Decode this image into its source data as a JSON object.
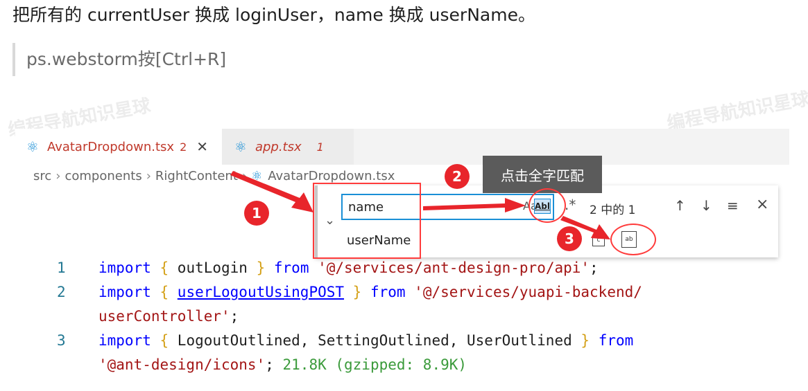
{
  "article": {
    "instruction": "把所有的 currentUser 换成 loginUser，name 换成 userName。",
    "tip": "ps.webstorm按[Ctrl+R]"
  },
  "watermark": "编程导航知识星球",
  "tabs": [
    {
      "label": "AvatarDropdown.tsx",
      "badge": "2",
      "close": "✕"
    },
    {
      "label": "app.tsx",
      "badge": "1"
    }
  ],
  "breadcrumb": [
    "src",
    "components",
    "RightContent",
    "AvatarDropdown.tsx"
  ],
  "tooltip": "点击全字匹配",
  "find_widget": {
    "find_value": "name",
    "replace_value": "userName",
    "whole_word_label": "Abl",
    "regex_label": ".*",
    "match_count": "2 中的 1"
  },
  "markers": [
    "1",
    "2",
    "3"
  ],
  "code": [
    {
      "num": "1",
      "tokens": [
        [
          "kw",
          "import"
        ],
        [
          "br",
          " { "
        ],
        [
          "id",
          "outLogin"
        ],
        [
          "br",
          " } "
        ],
        [
          "kw",
          "from"
        ],
        [
          "str",
          " '@/services/ant-design-pro/api'"
        ],
        [
          "id",
          ";"
        ]
      ]
    },
    {
      "num": "2",
      "tokens": [
        [
          "kw",
          "import"
        ],
        [
          "br",
          " { "
        ],
        [
          "link",
          "userLogoutUsingPOST"
        ],
        [
          "br",
          " } "
        ],
        [
          "kw",
          "from"
        ],
        [
          "str",
          " '@/services/yuapi-backend/"
        ]
      ]
    },
    {
      "num": "",
      "tokens": [
        [
          "str",
          "userController'"
        ],
        [
          "id",
          ";"
        ]
      ]
    },
    {
      "num": "3",
      "tokens": [
        [
          "kw",
          "import"
        ],
        [
          "br",
          " { "
        ],
        [
          "id",
          "LogoutOutlined, SettingOutlined, UserOutlined"
        ],
        [
          "br",
          " } "
        ],
        [
          "kw",
          "from"
        ]
      ]
    },
    {
      "num": "",
      "tokens": [
        [
          "str",
          "'@ant-design/icons'"
        ],
        [
          "id",
          ";  "
        ],
        [
          "size",
          "21.8K (gzipped: 8.9K)"
        ]
      ]
    }
  ],
  "colors": {
    "accent": "#1a8fd6",
    "annotation": "#e8252b"
  }
}
